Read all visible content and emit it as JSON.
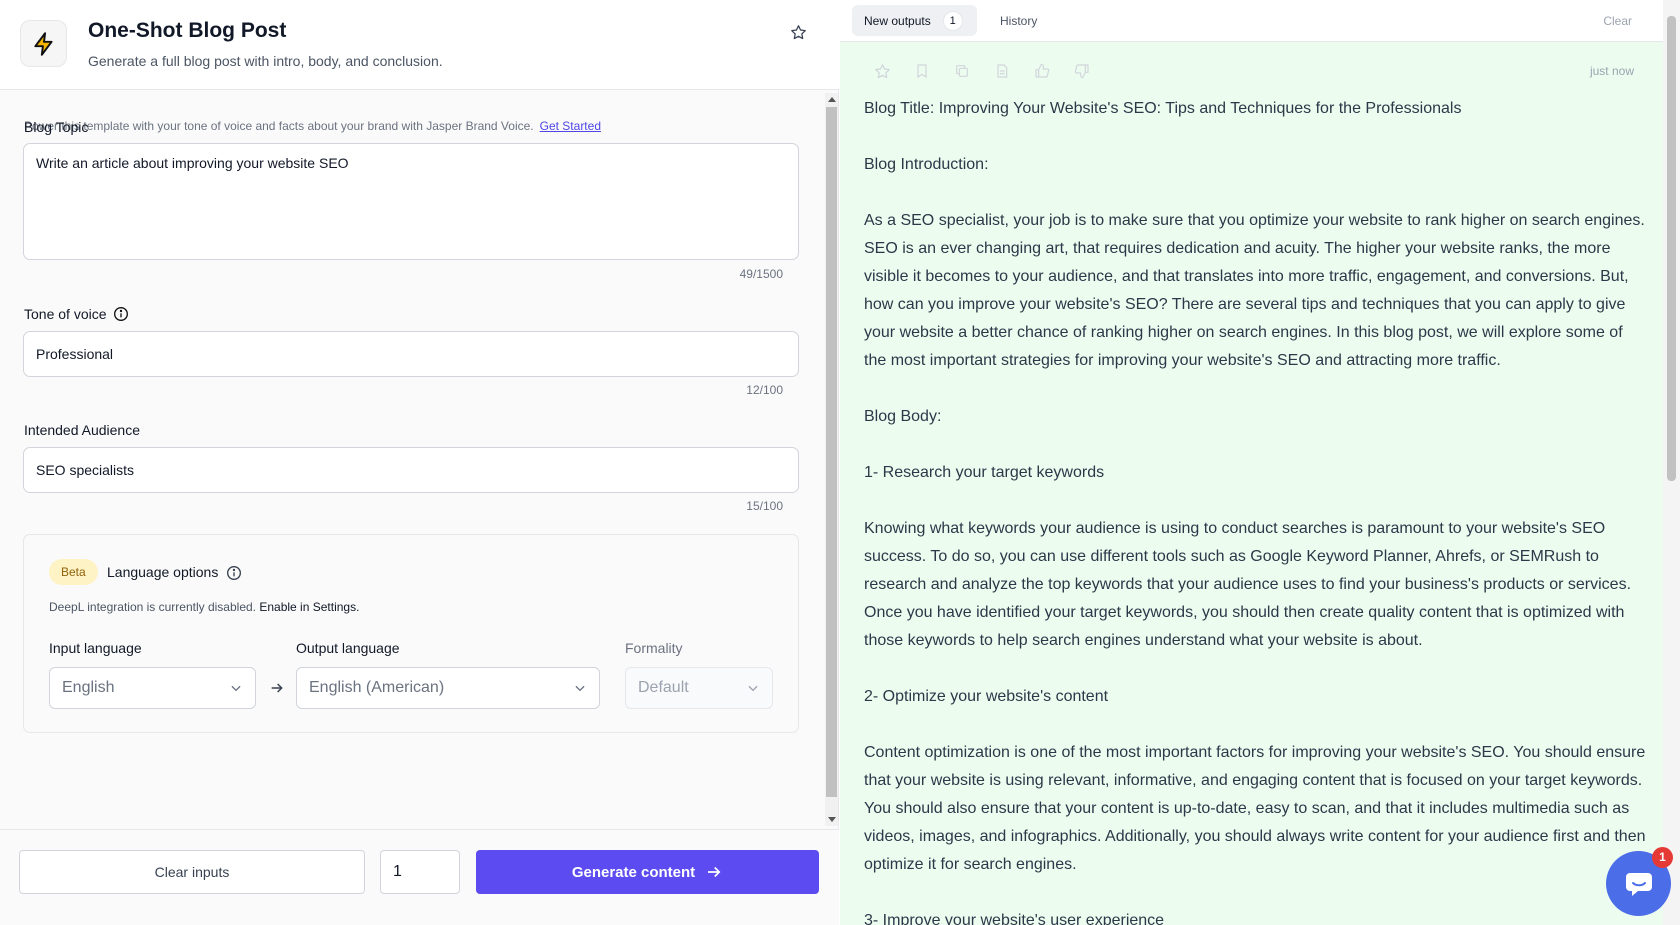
{
  "header": {
    "title": "One-Shot Blog Post",
    "subtitle": "Generate a full blog post with intro, body, and conclusion."
  },
  "form": {
    "hint_text": "Power this template with your tone of voice and facts about your brand with Jasper Brand Voice.",
    "hint_link": "Get Started",
    "topic": {
      "label": "Blog Topic",
      "value": "Write an article about improving your website SEO",
      "counter": "49/1500"
    },
    "tone": {
      "label": "Tone of voice",
      "value": "Professional",
      "counter": "12/100"
    },
    "audience": {
      "label": "Intended Audience",
      "value": "SEO specialists",
      "counter": "15/100"
    }
  },
  "language": {
    "badge": "Beta",
    "title": "Language options",
    "deepl_prefix": "DeepL integration is currently disabled.",
    "deepl_link": "Enable in Settings.",
    "input_label": "Input language",
    "input_value": "English",
    "output_label": "Output language",
    "output_value": "English (American)",
    "formality_label": "Formality",
    "formality_value": "Default"
  },
  "footer": {
    "clear_label": "Clear inputs",
    "quantity": "1",
    "generate_label": "Generate content"
  },
  "outputs": {
    "tab_new": "New outputs",
    "tab_new_count": "1",
    "tab_history": "History",
    "clear": "Clear",
    "timestamp": "just now",
    "paragraphs": [
      "Blog Title: Improving Your Website's SEO: Tips and Techniques for the Professionals",
      "Blog Introduction:",
      "As a SEO specialist, your job is to make sure that you optimize your website to rank higher on search engines. SEO is an ever changing art, that requires dedication and acuity. The higher your website ranks, the more visible it becomes to your audience, and that translates into more traffic, engagement, and conversions. But, how can you improve your website's SEO? There are several tips and techniques that you can apply to give your website a better chance of ranking higher on search engines. In this blog post, we will explore some of the most important strategies for improving your website's SEO and attracting more traffic.",
      "Blog Body:",
      "1- Research your target keywords",
      "Knowing what keywords your audience is using to conduct searches is paramount to your website's SEO success. To do so, you can use different tools such as Google Keyword Planner, Ahrefs, or SEMRush to research and analyze the top keywords that your audience uses to find your business's products or services. Once you have identified your target keywords, you should then create quality content that is optimized with those keywords to help search engines understand what your website is about.",
      "2- Optimize your website's content",
      "Content optimization is one of the most important factors for improving your website's SEO. You should ensure that your website is using relevant, informative, and engaging content that is focused on your target keywords. You should also ensure that your content is up-to-date, easy to scan, and that it includes multimedia such as videos, images, and infographics. Additionally, you should always write content for your audience first and then optimize it for search engines.",
      "3- Improve your website's user experience"
    ]
  },
  "chat": {
    "badge": "1"
  },
  "colors": {
    "primary": "#5b4bf0",
    "output_bg": "#ecfdf0",
    "beta_bg": "#fdf3c4"
  },
  "icons": [
    "lightning-icon",
    "star-icon",
    "info-icon",
    "chevron-down-icon",
    "arrow-right-icon",
    "bookmark-icon",
    "copy-icon",
    "document-icon",
    "thumbs-up-icon",
    "thumbs-down-icon",
    "chat-icon"
  ]
}
